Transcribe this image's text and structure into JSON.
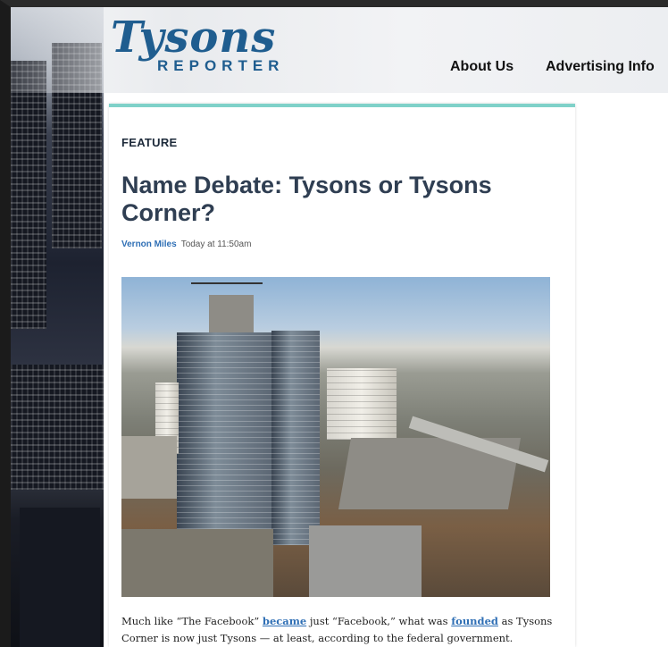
{
  "site": {
    "logo_script": "Tysons",
    "logo_sub": "REPORTER"
  },
  "nav": {
    "about": "About Us",
    "advertising": "Advertising Info"
  },
  "article": {
    "kicker": "FEATURE",
    "headline": "Name Debate: Tysons or Tysons Corner?",
    "author": "Vernon Miles",
    "date": "Today at 11:50am",
    "body": {
      "part1": "Much like “The Facebook” ",
      "link1": "became",
      "part2": " just “Facebook,” what was ",
      "link2": "founded",
      "part3": " as Tysons Corner is now just Tysons — at least, according to the federal government."
    }
  },
  "colors": {
    "brand": "#1f5d8f",
    "accent_bar": "#7fd1c9",
    "headline": "#2f3e52",
    "link": "#2f6fb5"
  }
}
